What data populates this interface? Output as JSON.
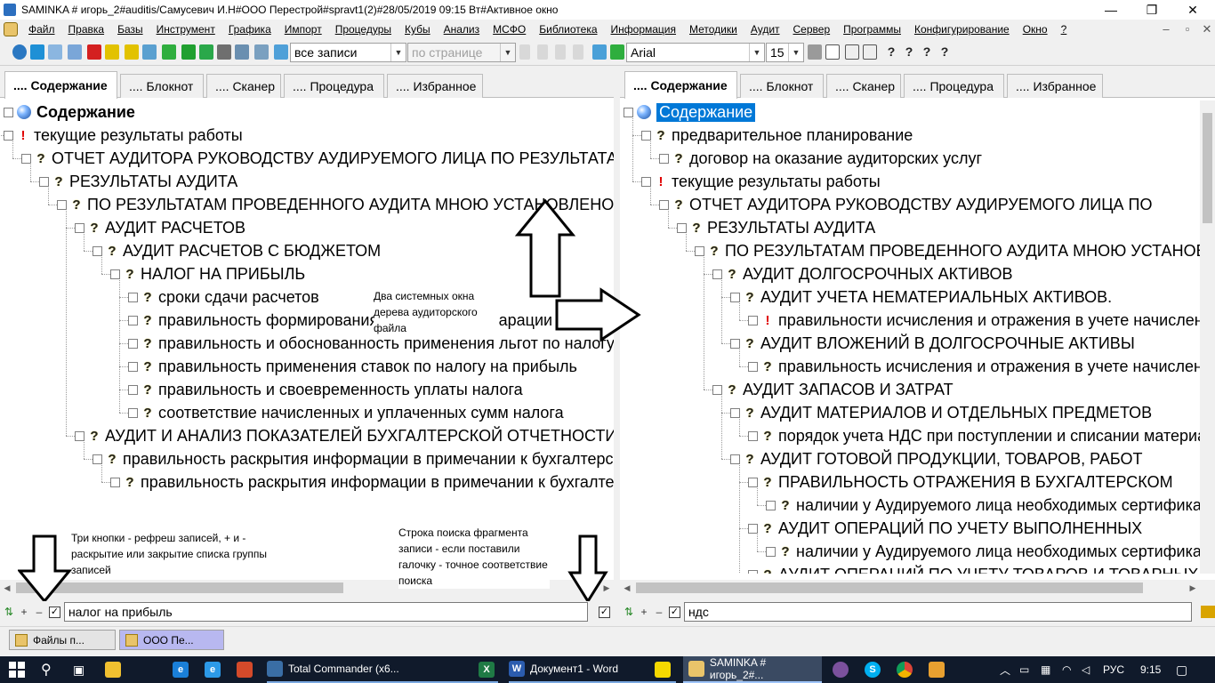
{
  "window": {
    "title": "SAMINKA # игорь_2#auditis/Самусевич И.Н#ООО Перестрой#spravt1(2)#28/05/2019 09:15 Вт#Активное окно"
  },
  "menu": [
    "Файл",
    "Правка",
    "Базы",
    "Инструмент",
    "Графика",
    "Импорт",
    "Процедуры",
    "Кубы",
    "Анализ",
    "МСФО",
    "Библиотека",
    "Информация",
    "Методики",
    "Аудит",
    "Сервер",
    "Программы",
    "Конфигурирование",
    "Окно",
    "?"
  ],
  "toolbar": {
    "records_combo": "все записи",
    "page_combo": "по странице",
    "font_combo": "Arial",
    "size_combo": "15"
  },
  "tabs": [
    ".... Содержание",
    ".... Блокнот",
    ".... Сканер",
    ".... Процедура",
    ".... Избранное"
  ],
  "left_tree": [
    {
      "t": "Содержание",
      "i": "globe",
      "l": 0,
      "bold": true
    },
    {
      "t": "текущие результаты работы",
      "i": "ex",
      "l": 0
    },
    {
      "t": "ОТЧЕТ АУДИТОРА РУКОВОДСТВУ АУДИРУЕМОГО ЛИЦА ПО РЕЗУЛЬТАТАМ",
      "i": "q",
      "l": 1
    },
    {
      "t": "РЕЗУЛЬТАТЫ АУДИТА",
      "i": "q",
      "l": 2
    },
    {
      "t": "ПО РЕЗУЛЬТАТАМ ПРОВЕДЕННОГО АУДИТА МНОЮ УСТАНОВЛЕНО",
      "i": "q",
      "l": 3
    },
    {
      "t": "АУДИТ РАСЧЕТОВ",
      "i": "q",
      "l": 4
    },
    {
      "t": "АУДИТ РАСЧЕТОВ С БЮДЖЕТОМ",
      "i": "q",
      "l": 5
    },
    {
      "t": "НАЛОГ НА ПРИБЫЛЬ",
      "i": "q",
      "l": 6
    },
    {
      "t": "сроки сдачи расчетов",
      "i": "q",
      "l": 7
    },
    {
      "t": "правильность формирования налоговой декларации",
      "i": "q",
      "l": 7
    },
    {
      "t": "правильность и обоснованность применения льгот по налогу",
      "i": "q",
      "l": 7
    },
    {
      "t": "правильность применения ставок по налогу на прибыль",
      "i": "q",
      "l": 7
    },
    {
      "t": "правильность и своевременность уплаты налога",
      "i": "q",
      "l": 7
    },
    {
      "t": "соответствие начисленных и уплаченных сумм налога",
      "i": "q",
      "l": 7
    },
    {
      "t": "АУДИТ И АНАЛИЗ ПОКАЗАТЕЛЕЙ БУХГАЛТЕРСКОЙ ОТЧЕТНОСТИ",
      "i": "q",
      "l": 4
    },
    {
      "t": "правильность раскрытия информации в примечании к бухгалтерской",
      "i": "q",
      "l": 5
    },
    {
      "t": "правильность раскрытия информации в примечании к бухгалтерской",
      "i": "q",
      "l": 6
    }
  ],
  "right_tree": [
    {
      "t": "Содержание",
      "i": "globe",
      "l": 0,
      "sel": true
    },
    {
      "t": "предварительное планирование",
      "i": "q",
      "l": 1
    },
    {
      "t": "договор на оказание аудиторских услуг",
      "i": "q",
      "l": 2
    },
    {
      "t": "текущие результаты работы",
      "i": "ex",
      "l": 1
    },
    {
      "t": "ОТЧЕТ АУДИТОРА РУКОВОДСТВУ АУДИРУЕМОГО ЛИЦА ПО",
      "i": "q",
      "l": 2
    },
    {
      "t": "РЕЗУЛЬТАТЫ АУДИТА",
      "i": "q",
      "l": 3
    },
    {
      "t": "ПО РЕЗУЛЬТАТАМ ПРОВЕДЕННОГО АУДИТА МНОЮ УСТАНОВЛЕНО",
      "i": "q",
      "l": 4
    },
    {
      "t": "АУДИТ ДОЛГОСРОЧНЫХ АКТИВОВ",
      "i": "q",
      "l": 5
    },
    {
      "t": "АУДИТ УЧЕТА НЕМАТЕРИАЛЬНЫХ АКТИВОВ.",
      "i": "q",
      "l": 6
    },
    {
      "t": "правильности исчисления и отражения в учете начисленной",
      "i": "ex",
      "l": 7
    },
    {
      "t": "АУДИТ ВЛОЖЕНИЙ В ДОЛГОСРОЧНЫЕ АКТИВЫ",
      "i": "q",
      "l": 6
    },
    {
      "t": "правильность исчисления и отражения в учете начисленной",
      "i": "q",
      "l": 7
    },
    {
      "t": "АУДИТ ЗАПАСОВ И ЗАТРАТ",
      "i": "q",
      "l": 5
    },
    {
      "t": "АУДИТ МАТЕРИАЛОВ И ОТДЕЛЬНЫХ ПРЕДМЕТОВ",
      "i": "q",
      "l": 6
    },
    {
      "t": "порядок учета НДС при поступлении и списании материалов",
      "i": "q",
      "l": 7
    },
    {
      "t": "АУДИТ ГОТОВОЙ ПРОДУКЦИИ, ТОВАРОВ, РАБОТ",
      "i": "q",
      "l": 6
    },
    {
      "t": "ПРАВИЛЬНОСТЬ ОТРАЖЕНИЯ В БУХГАЛТЕРСКОМ",
      "i": "q",
      "l": 7
    },
    {
      "t": "наличии у Аудируемого лица необходимых сертификатов",
      "i": "q",
      "l": 8
    },
    {
      "t": "АУДИТ ОПЕРАЦИЙ ПО УЧЕТУ ВЫПОЛНЕННЫХ",
      "i": "q",
      "l": 7
    },
    {
      "t": "наличии у Аудируемого лица необходимых сертификатов",
      "i": "q",
      "l": 8
    },
    {
      "t": "АУДИТ ОПЕРАЦИЙ ПО УЧЕТУ ТОВАРОВ И ТОВАРНЫХ",
      "i": "q",
      "l": 7
    }
  ],
  "annotations": {
    "windows": "Два системных окна дерева аудиторского файла",
    "buttons": "Три кнопки - рефреш записей, + и - раскрытие или закрытие списка группы записей",
    "search": "Строка поиска фрагмента записи - если поставили галочку - точное соответствие поиска"
  },
  "left_search": {
    "plus": "+",
    "minus": "–",
    "value": "налог на прибыль"
  },
  "right_search": {
    "plus": "+",
    "minus": "–",
    "value": "ндс"
  },
  "task_strip": [
    "Файлы п...",
    "ООО Пе..."
  ],
  "taskbar": {
    "items": [
      "Total Commander (x6...",
      "Документ1 - Word",
      "SAMINKA # игорь_2#..."
    ],
    "lang": "РУС",
    "time": "9:15"
  }
}
